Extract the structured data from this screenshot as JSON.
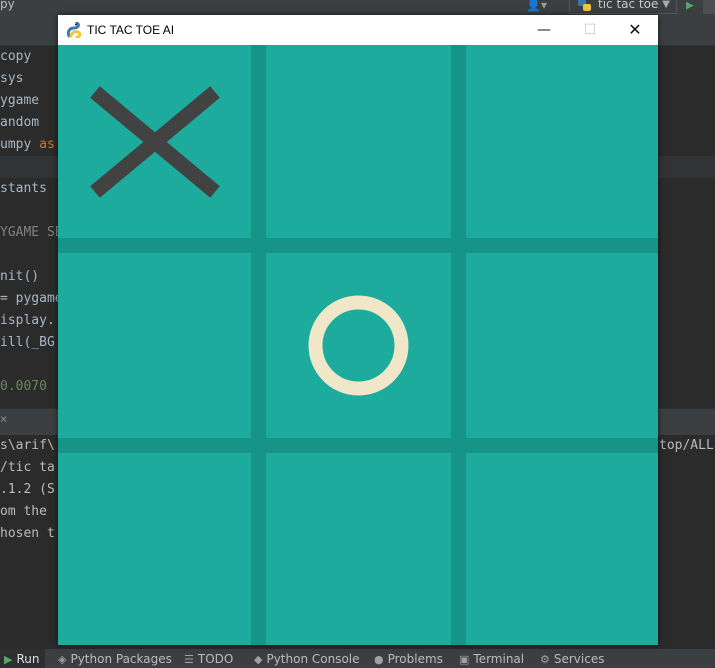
{
  "ide": {
    "top_left": "py",
    "run_config": "tic tac toe",
    "code_lines": [
      "copy",
      "sys",
      "ygame",
      "andom",
      "umpy ",
      "as",
      "stants",
      "YGAME SE",
      "nit()",
      "= pygame",
      "isplay.",
      "ill(_BG",
      "0.0070"
    ],
    "console_lines": [
      "s\\arif\\",
      "/tic ta",
      ".1.2 (S",
      "om the",
      "hosen t"
    ],
    "console_right": "top/ALL",
    "status_bar": [
      {
        "label": "Run",
        "icon": "run-icon"
      },
      {
        "label": "Python Packages",
        "icon": "packages-icon"
      },
      {
        "label": "TODO",
        "icon": "todo-icon"
      },
      {
        "label": "Python Console",
        "icon": "python-console-icon"
      },
      {
        "label": "Problems",
        "icon": "problems-icon"
      },
      {
        "label": "Terminal",
        "icon": "terminal-icon"
      },
      {
        "label": "Services",
        "icon": "services-icon"
      }
    ]
  },
  "window": {
    "title": "TIC TAC TOE AI",
    "controls": {
      "minimize": "—",
      "maximize": "☐",
      "close": "✕"
    }
  },
  "board": {
    "colors": {
      "background": "#1cab9c",
      "lines": "#169488",
      "x_mark": "#424242",
      "o_mark": "#efe7c8"
    },
    "cells": [
      "X",
      "",
      "",
      "",
      "O",
      "",
      "",
      "",
      ""
    ]
  }
}
